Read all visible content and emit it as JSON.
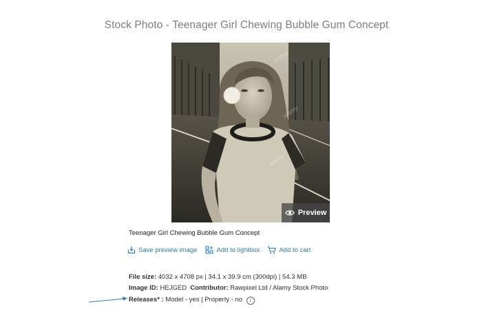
{
  "page": {
    "title": "Stock Photo - Teenager Girl Chewing Bubble Gum Concept"
  },
  "image": {
    "preview_label": "Preview",
    "watermark": "alamy"
  },
  "caption": "Teenager Girl Chewing Bubble Gum Concept",
  "actions": [
    {
      "label": "Save preview image",
      "icon": "download-icon"
    },
    {
      "label": "Add to lightbox",
      "icon": "lightbox-icon"
    },
    {
      "label": "Add to cart",
      "icon": "cart-icon"
    }
  ],
  "details": {
    "file_size_label": "File size:",
    "file_size_value": "4032 x 4708 px | 34.1 x 39.9 cm (300dpi) | 54.3 MB",
    "image_id_label": "Image ID:",
    "image_id_value": "HEJGED",
    "contributor_label": "Contributor:",
    "contributor_value": "Rawpixel Ltd / Alamy Stock Photo",
    "releases_label": "Releases* :",
    "releases_value": "Model - yes | Property - no",
    "info_glyph": "i"
  },
  "colors": {
    "link": "#2f7fc1",
    "title": "#7a7f8a",
    "arrow": "#3c74b0"
  }
}
